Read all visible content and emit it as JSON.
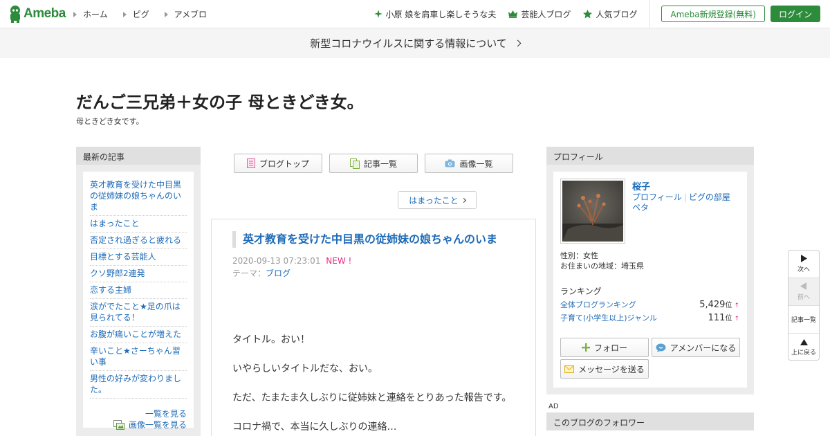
{
  "header": {
    "logo_text": "Ameba",
    "nav": [
      "ホーム",
      "ピグ",
      "アメブロ"
    ],
    "links": [
      {
        "icon": "sparkle-icon",
        "label": "小原 娘を肩車し楽しそうな夫"
      },
      {
        "icon": "crown-icon",
        "label": "芸能人ブログ"
      },
      {
        "icon": "star-icon",
        "label": "人気ブログ"
      }
    ],
    "register_label": "Ameba新規登録(無料)",
    "login_label": "ログイン"
  },
  "notice": {
    "text": "新型コロナウイルスに関する情報について"
  },
  "blog": {
    "title": "だんご三兄弟＋女の子 母ときどき女。",
    "description": "母ときどき女です。"
  },
  "left_sidebar": {
    "heading": "最新の記事",
    "items": [
      "英才教育を受けた中目黒の従姉妹の娘ちゃんのいま",
      "はまったこと",
      "否定され過ぎると疲れる",
      "目標とする芸能人",
      "クソ野郎2連発",
      "恋する主婦",
      "涙がでたこと★足の爪は見られてる！",
      "お腹が痛いことが増えた",
      "辛いこと★さーちゃん習い事",
      "男性の好みが変わりました。"
    ],
    "list_link": "一覧を見る",
    "image_list_link": "画像一覧を見る"
  },
  "tabs": [
    {
      "icon": "document-icon",
      "label": "ブログトップ"
    },
    {
      "icon": "copy-icon",
      "label": "記事一覧"
    },
    {
      "icon": "camera-icon",
      "label": "画像一覧"
    }
  ],
  "theme_pill": "はまったこと",
  "entry": {
    "title": "英才教育を受けた中目黒の従姉妹の娘ちゃんのいま",
    "date": "2020-09-13 07:23:01",
    "new_badge": "NEW !",
    "theme_label": "テーマ：",
    "theme_link": "ブログ",
    "paragraphs": [
      "タイトル。おい！",
      "いやらしいタイトルだな、おい。",
      "ただ、たまたま久しぶりに従姉妹と連絡をとりあった報告です。",
      "コロナ禍で、本当に久しぶりの連絡…"
    ]
  },
  "profile": {
    "heading": "プロフィール",
    "name": "桜子",
    "link_profile": "プロフィール",
    "link_pig_room": "ピグの部屋",
    "link_peta": "ペタ",
    "gender": "性別：女性",
    "location": "お住まいの地域：埼玉県",
    "ranking_heading": "ランキング",
    "rankings": [
      {
        "label": "全体ブログランキング",
        "value": "5,429",
        "unit": "位",
        "arrow": "↑"
      },
      {
        "label": "子育て(小学生以上)ジャンル",
        "value": "111",
        "unit": "位",
        "arrow": "↑"
      }
    ],
    "follow_label": "フォロー",
    "amember_label": "アメンバーになる",
    "message_label": "メッセージを送る"
  },
  "ad_label": "AD",
  "followers_heading": "このブログのフォロワー",
  "float_nav": {
    "next": "次へ",
    "prev": "前へ",
    "list": "記事一覧",
    "top": "上に戻る"
  },
  "colors": {
    "brand_green": "#2d8c3c",
    "link_blue": "#1e6bb8",
    "new_pink": "#e5297f"
  }
}
